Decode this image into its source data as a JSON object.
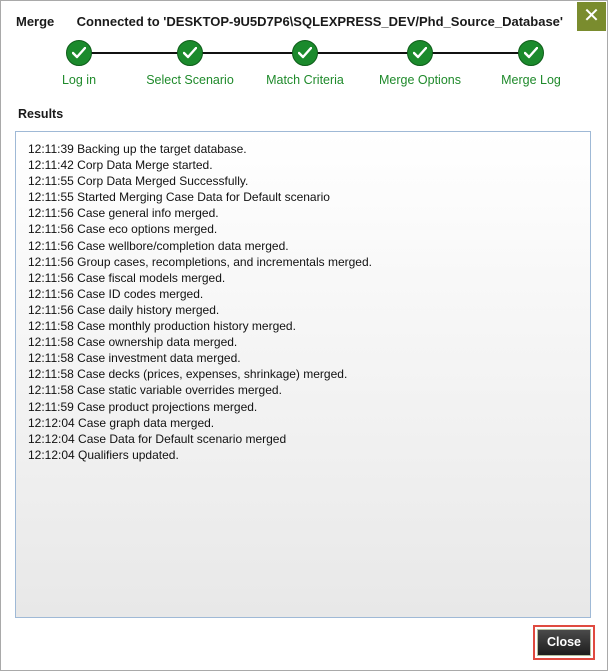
{
  "window": {
    "title": "Merge",
    "connection_text": "Connected to 'DESKTOP-9U5D7P6\\SQLEXPRESS_DEV/Phd_Source_Database'",
    "close_glyph": "✕",
    "accent_color": "#7a8c2e"
  },
  "stepper": {
    "step_color": "#1b8a2c",
    "steps": [
      {
        "label": "Log in",
        "status": "complete"
      },
      {
        "label": "Select Scenario",
        "status": "complete"
      },
      {
        "label": "Match Criteria",
        "status": "complete"
      },
      {
        "label": "Merge Options",
        "status": "complete"
      },
      {
        "label": "Merge Log",
        "status": "complete"
      }
    ]
  },
  "results": {
    "label": "Results",
    "lines": [
      "12:11:39 Backing up the target database.",
      "12:11:42 Corp Data Merge started.",
      "12:11:55 Corp Data Merged Successfully.",
      "12:11:55 Started Merging Case Data for Default scenario",
      "12:11:56 Case general info merged.",
      "12:11:56 Case eco options merged.",
      "12:11:56 Case wellbore/completion data merged.",
      "12:11:56 Group cases, recompletions, and incrementals merged.",
      "12:11:56 Case fiscal models merged.",
      "12:11:56 Case ID codes merged.",
      "12:11:56 Case daily history merged.",
      "12:11:58 Case monthly production history merged.",
      "12:11:58 Case ownership data merged.",
      "12:11:58 Case investment data merged.",
      "12:11:58 Case decks (prices, expenses, shrinkage) merged.",
      "12:11:58 Case static variable overrides merged.",
      "12:11:59 Case product projections merged.",
      "12:12:04 Case graph data merged.",
      "12:12:04 Case Data for Default scenario merged",
      "12:12:04 Qualifiers updated."
    ]
  },
  "footer": {
    "close_label": "Close",
    "highlight_color": "#e04a40"
  }
}
